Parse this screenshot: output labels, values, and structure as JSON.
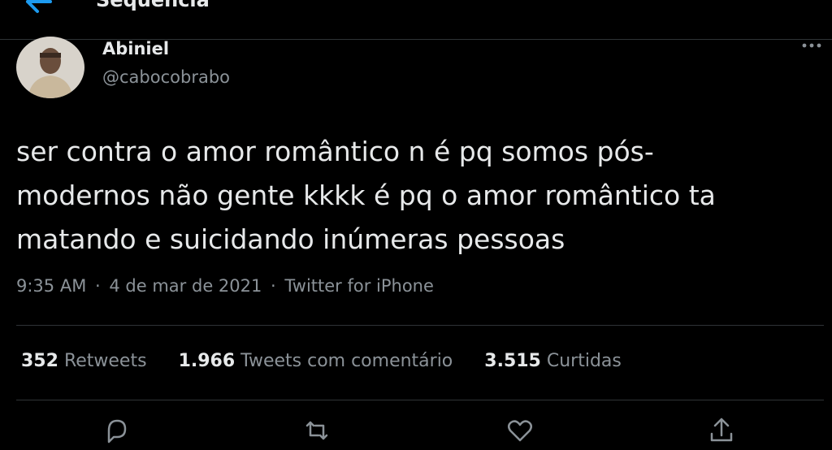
{
  "header": {
    "title": "Sequência"
  },
  "tweet": {
    "author": {
      "name": "Abiniel",
      "handle": "@cabocobrabo"
    },
    "text": "ser contra o amor romântico n é pq somos pós-\nmodernos não gente kkkk é pq o amor romântico ta\nmatando e suicidando inúmeras pessoas",
    "time": "9:35 AM",
    "date": "4 de mar de 2021",
    "separator": "·",
    "source": "Twitter for iPhone",
    "stats": {
      "retweets_count": "352",
      "retweets_label": "Retweets",
      "quotes_count": "1.966",
      "quotes_label": "Tweets com comentário",
      "likes_count": "3.515",
      "likes_label": "Curtidas"
    }
  },
  "colors": {
    "background": "#000000",
    "accent": "#1d9bf0",
    "text_primary": "#e7e9ea",
    "text_secondary": "#8b9298",
    "divider": "#2f3336"
  },
  "icons": {
    "back": "arrow-left-icon",
    "more": "more-horizontal-icon",
    "reply": "reply-icon",
    "retweet": "retweet-icon",
    "like": "heart-icon",
    "share": "share-icon"
  }
}
